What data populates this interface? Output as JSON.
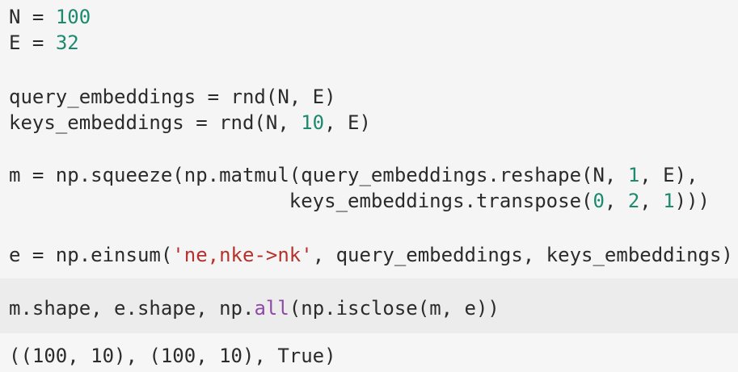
{
  "code": {
    "n_name": "N",
    "eq": " = ",
    "n_val": "100",
    "e_name": "E",
    "e_val": "32",
    "q_lhs": "query_embeddings = rnd(N, E)",
    "k_lhs": "keys_embeddings = rnd(N, ",
    "k_num": "10",
    "k_end": ", E)",
    "m_line1": "m = np.squeeze(np.matmul(query_embeddings.reshape(N, ",
    "m_one": "1",
    "m_line1_end": ", E),",
    "m_line2_pre": "                        keys_embeddings.transpose(",
    "m_zero": "0",
    "m_comma": ", ",
    "m_two": "2",
    "m_comma2": ", ",
    "m_one2": "1",
    "m_line2_end": ")))",
    "e_pre": "e = np.einsum(",
    "e_str": "'ne,nke->nk'",
    "e_end": ", query_embeddings, keys_embeddings)",
    "last_pre": "m.shape, e.shape, np.",
    "last_fn": "all",
    "last_end": "(np.isclose(m, e))"
  },
  "output": {
    "text": "((100, 10), (100, 10), True)"
  }
}
